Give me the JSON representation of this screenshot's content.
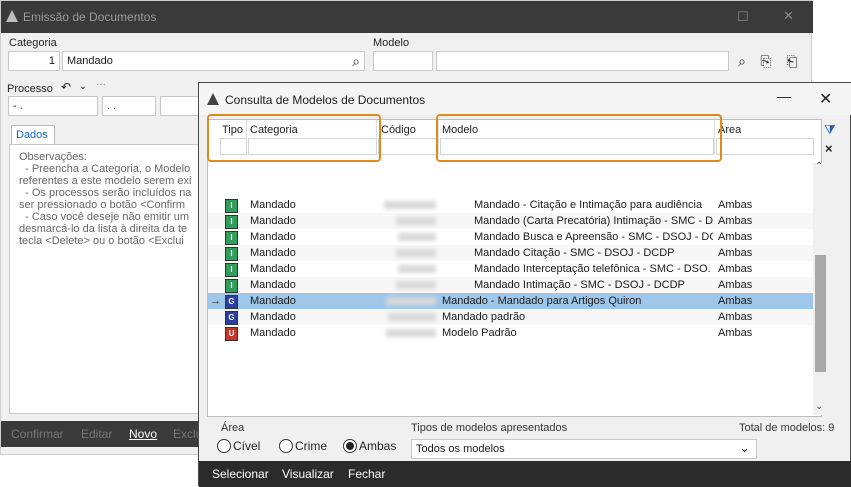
{
  "background_window": {
    "title": "Emissão de Documentos",
    "categoria_label": "Categoria",
    "categoria_code": "1",
    "categoria_value": "Mandado",
    "modelo_label": "Modelo",
    "processo_label": "Processo",
    "processo_fields": [
      "- .",
      ". .",
      ""
    ],
    "tab_label": "Dados",
    "observacoes": "Observações:\n  - Preencha a Categoria, o Modelo\nreferentes a este modelo serem exi\n  - Os processos serão incluídos na\nser pressionado o botão <Confirm\n  - Caso você deseje não emitir um\ndesmarcá-lo da lista à direita da te\ntecla <Delete> ou o botão <Exclui",
    "footer_buttons": [
      "Confirmar",
      "Editar",
      "Novo",
      "Exclu"
    ]
  },
  "dialog": {
    "title": "Consulta de Modelos de Documentos",
    "columns": {
      "tipo": "Tipo",
      "categoria": "Categoria",
      "codigo": "Código",
      "modelo": "Modelo",
      "area": "Área"
    },
    "rows": [
      {
        "tipo": "I",
        "categoria": "Mandado",
        "modelo": "Mandado - Citação e Intimação para audiência",
        "area": "Ambas",
        "selected": false
      },
      {
        "tipo": "I",
        "categoria": "Mandado",
        "modelo": "Mandado (Carta Precatória) Intimação - SMC - D",
        "area": "Ambas",
        "selected": false
      },
      {
        "tipo": "I",
        "categoria": "Mandado",
        "modelo": "Mandado Busca e Apreensão - SMC - DSOJ - DC",
        "area": "Ambas",
        "selected": false
      },
      {
        "tipo": "I",
        "categoria": "Mandado",
        "modelo": "Mandado Citação - SMC - DSOJ - DCDP",
        "area": "Ambas",
        "selected": false
      },
      {
        "tipo": "I",
        "categoria": "Mandado",
        "modelo": "Mandado Interceptação telefônica - SMC - DSO.",
        "area": "Ambas",
        "selected": false
      },
      {
        "tipo": "I",
        "categoria": "Mandado",
        "modelo": "Mandado Intimação - SMC - DSOJ - DCDP",
        "area": "Ambas",
        "selected": false
      },
      {
        "tipo": "G",
        "categoria": "Mandado",
        "modelo": "Mandado - Mandado para Artigos Quiron",
        "area": "Ambas",
        "selected": true
      },
      {
        "tipo": "G",
        "categoria": "Mandado",
        "modelo": "Mandado padrão",
        "area": "Ambas",
        "selected": false
      },
      {
        "tipo": "U",
        "categoria": "Mandado",
        "modelo": "Modelo Padrão",
        "area": "Ambas",
        "selected": false
      }
    ],
    "tipo_colors": {
      "I": "#2e9e5a",
      "G": "#2c3e9e",
      "U": "#c0392b"
    },
    "area_group_label": "Área",
    "area_options": [
      "Cível",
      "Crime",
      "Ambas"
    ],
    "area_selected": "Ambas",
    "tipos_label": "Tipos de modelos apresentados",
    "tipos_value": "Todos os modelos",
    "total_label": "Total de modelos: 9",
    "footer_buttons": [
      "Selecionar",
      "Visualizar",
      "Fechar"
    ],
    "highlight_color": "#e08a1e",
    "selection_color": "#9fc7ea"
  }
}
